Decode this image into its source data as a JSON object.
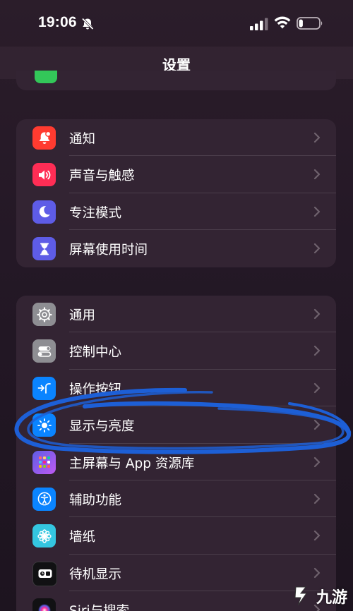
{
  "status_bar": {
    "time": "19:06",
    "muted": true,
    "battery_level": 0.2
  },
  "nav": {
    "title": "设置"
  },
  "groups": [
    {
      "items": [
        {
          "label": "通知",
          "icon": "bell-icon",
          "color": "#ff3b30"
        },
        {
          "label": "声音与触感",
          "icon": "speaker-icon",
          "color": "#ff2d55"
        },
        {
          "label": "专注模式",
          "icon": "moon-icon",
          "color": "#5e5ce6"
        },
        {
          "label": "屏幕使用时间",
          "icon": "hourglass-icon",
          "color": "#5e5ce6"
        }
      ]
    },
    {
      "items": [
        {
          "label": "通用",
          "icon": "gear-icon",
          "color": "#8e8e93"
        },
        {
          "label": "控制中心",
          "icon": "toggles-icon",
          "color": "#8e8e93"
        },
        {
          "label": "操作按钮",
          "icon": "action-button-icon",
          "color": "#0a84ff"
        },
        {
          "label": "显示与亮度",
          "icon": "sun-icon",
          "color": "#0a84ff"
        },
        {
          "label": "主屏幕与 App 资源库",
          "icon": "app-grid-icon",
          "color": "#5e5ce6"
        },
        {
          "label": "辅助功能",
          "icon": "accessibility-icon",
          "color": "#0a84ff"
        },
        {
          "label": "墙纸",
          "icon": "flower-icon",
          "color": "#34c6e0"
        },
        {
          "label": "待机显示",
          "icon": "standby-icon",
          "color": "#1c1c1e"
        },
        {
          "label": "Siri与搜索",
          "icon": "siri-icon",
          "color": "#1c1c1e"
        }
      ]
    }
  ],
  "watermark": {
    "text": "九游"
  },
  "colors": {
    "annotation": "#1d5fd6",
    "background": "#241826",
    "group_background": "#332433"
  }
}
